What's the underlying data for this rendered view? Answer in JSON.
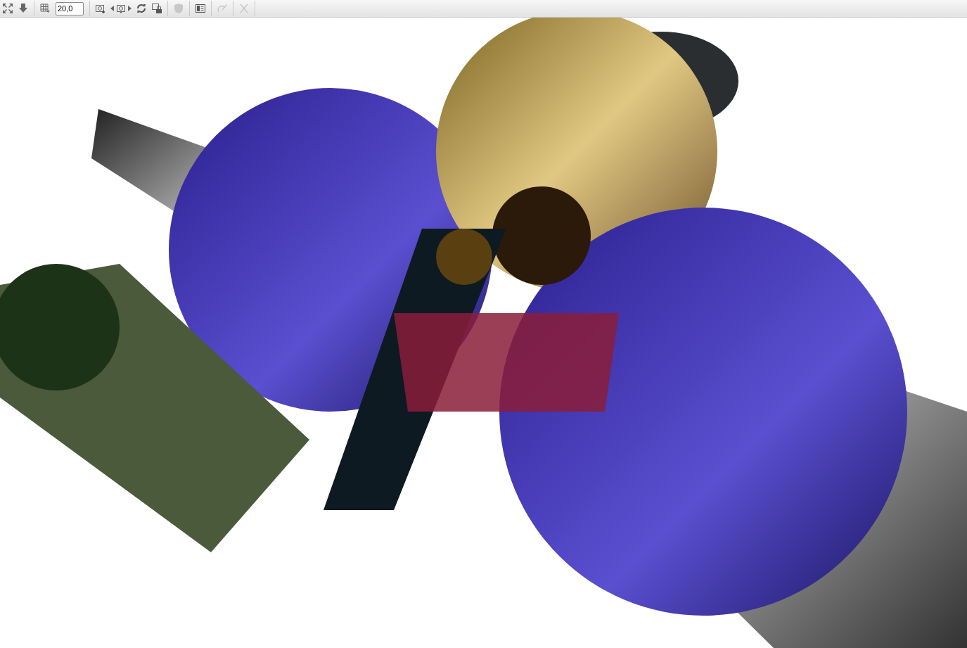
{
  "toolbar": {
    "items": [
      {
        "kind": "button",
        "disabled": false
      },
      {
        "kind": "button",
        "disabled": false
      },
      {
        "kind": "separator"
      },
      {
        "kind": "button",
        "disabled": false
      },
      {
        "kind": "field",
        "value": "20,0"
      },
      {
        "kind": "separator"
      },
      {
        "kind": "button",
        "disabled": false
      },
      {
        "kind": "stepper",
        "disabled": false
      },
      {
        "kind": "button",
        "disabled": false
      },
      {
        "kind": "button",
        "disabled": false
      },
      {
        "kind": "separator"
      },
      {
        "kind": "button",
        "disabled": true
      },
      {
        "kind": "separator"
      },
      {
        "kind": "button",
        "disabled": false
      },
      {
        "kind": "separator"
      },
      {
        "kind": "button",
        "disabled": true
      },
      {
        "kind": "separator"
      },
      {
        "kind": "button",
        "disabled": true
      },
      {
        "kind": "separator"
      }
    ]
  }
}
